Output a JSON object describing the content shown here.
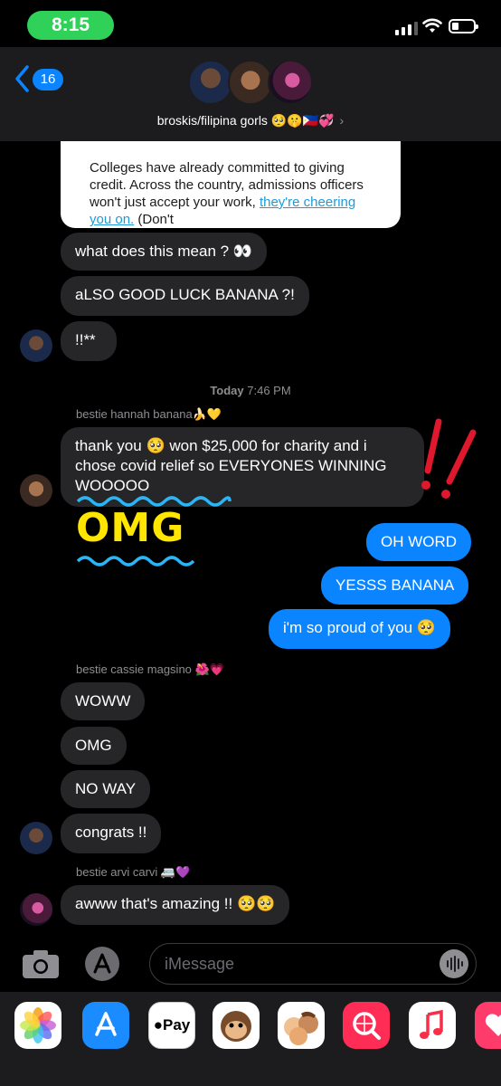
{
  "status": {
    "time": "8:15"
  },
  "header": {
    "back_count": "16",
    "group_name": "broskis/filipina gorls 🥺🤫🇵🇭💞"
  },
  "article": {
    "text_before": "Colleges have already committed to giving credit. Across the country, admissions officers won't just accept your work, ",
    "link": "they're cheering you on.",
    "text_after": " (Don't"
  },
  "messages": {
    "m1": "what does this mean ? 👀",
    "m2": "aLSO GOOD LUCK BANANA ?!",
    "m3": "!!**",
    "timestamp_day": "Today",
    "timestamp_time": " 7:46 PM",
    "sender_hannah": "bestie hannah banana🍌💛",
    "m4": "thank you 🥺 won $25,000 for charity and i chose covid relief so EVERYONES WINNING WOOOOO",
    "omg_sticker": "OMG",
    "me1": "OH WORD",
    "me2": "YESSS BANANA",
    "me3": "i'm so proud of you 🥺",
    "sender_cassie": "bestie cassie magsino 🌺💗",
    "m5": "WOWW",
    "m6": "OMG",
    "m7": "NO WAY",
    "m8": "congrats !!",
    "sender_arvi": "bestie arvi carvi 🚐💜",
    "m9": "awww that's amazing !! 🥺🥺"
  },
  "input": {
    "placeholder": "iMessage"
  },
  "apps": {
    "applepay": "Pay"
  },
  "colors": {
    "accent": "#0a84ff",
    "bubble_grey": "#262629",
    "status_green": "#30d158"
  },
  "icons": [
    "back-chevron-icon",
    "signal-icon",
    "wifi-icon",
    "battery-icon",
    "camera-icon",
    "app-store-icon",
    "voice-icon",
    "photos-icon",
    "apple-pay-icon",
    "animoji-icon",
    "memoji-icon",
    "web-search-icon",
    "music-icon",
    "heart-app-icon"
  ]
}
